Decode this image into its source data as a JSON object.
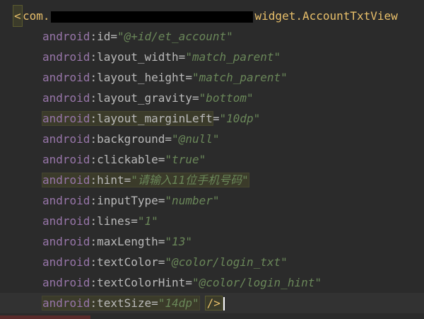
{
  "tag": {
    "prefix": "com.",
    "suffix": "widget.AccountTxtView",
    "close": "/>"
  },
  "attributes": [
    {
      "ns": "android",
      "sep": ":",
      "name": "id",
      "eq": "=",
      "value": "\"@+id/et_account\""
    },
    {
      "ns": "android",
      "sep": ":",
      "name": "layout_width",
      "eq": "=",
      "value": "\"match_parent\""
    },
    {
      "ns": "android",
      "sep": ":",
      "name": "layout_height",
      "eq": "=",
      "value": "\"match_parent\""
    },
    {
      "ns": "android",
      "sep": ":",
      "name": "layout_gravity",
      "eq": "=",
      "value": "\"bottom\""
    },
    {
      "ns": "android",
      "sep": ":",
      "name": "layout_marginLeft",
      "eq": "=",
      "value": "\"10dp\""
    },
    {
      "ns": "android",
      "sep": ":",
      "name": "background",
      "eq": "=",
      "value": "\"@null\""
    },
    {
      "ns": "android",
      "sep": ":",
      "name": "clickable",
      "eq": "=",
      "value": "\"true\""
    },
    {
      "ns": "android",
      "sep": ":",
      "name": "hint",
      "eq": "=",
      "value": "\"请输入11位手机号码\""
    },
    {
      "ns": "android",
      "sep": ":",
      "name": "inputType",
      "eq": "=",
      "value": "\"number\""
    },
    {
      "ns": "android",
      "sep": ":",
      "name": "lines",
      "eq": "=",
      "value": "\"1\""
    },
    {
      "ns": "android",
      "sep": ":",
      "name": "maxLength",
      "eq": "=",
      "value": "\"13\""
    },
    {
      "ns": "android",
      "sep": ":",
      "name": "textColor",
      "eq": "=",
      "value": "\"@color/login_txt\""
    },
    {
      "ns": "android",
      "sep": ":",
      "name": "textColorHint",
      "eq": "=",
      "value": "\"@color/login_hint\""
    },
    {
      "ns": "android",
      "sep": ":",
      "name": "textSize",
      "eq": "=",
      "value": "\"14dp\""
    }
  ],
  "colors": {
    "background": "#2b2b2b",
    "namespace": "#9876aa",
    "attribute": "#bababa",
    "value": "#6a8759",
    "tag": "#e8bf6a"
  }
}
